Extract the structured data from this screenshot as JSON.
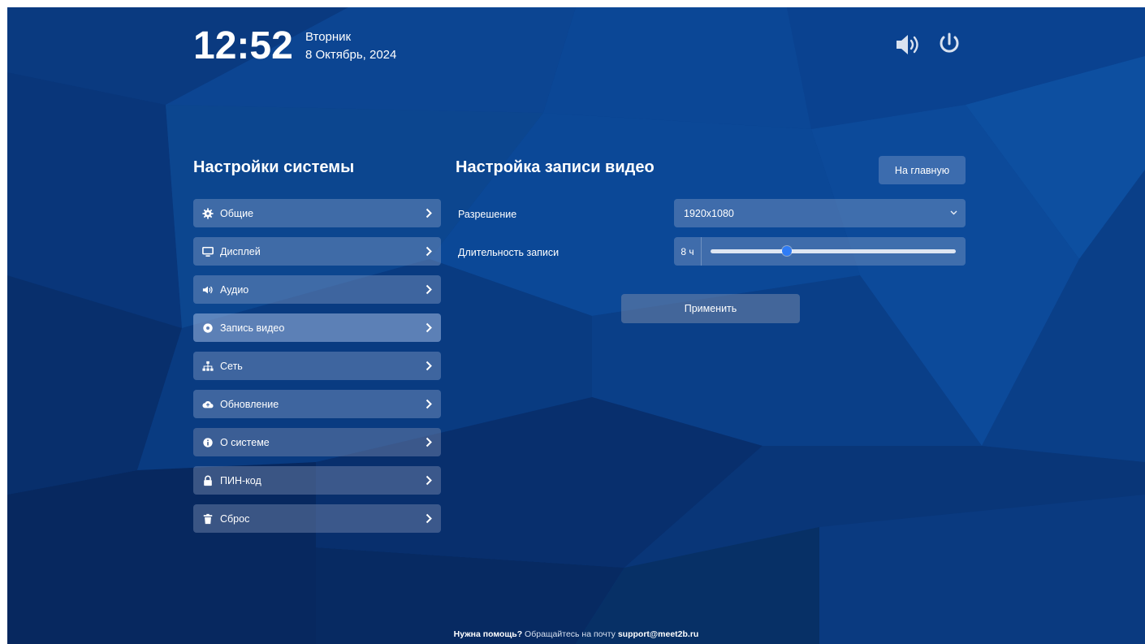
{
  "clock": {
    "time": "12:52",
    "weekday": "Вторник",
    "date": "8 Октябрь, 2024"
  },
  "sidebar": {
    "title": "Настройки системы",
    "items": [
      {
        "label": "Общие",
        "icon": "gear-icon"
      },
      {
        "label": "Дисплей",
        "icon": "monitor-icon"
      },
      {
        "label": "Аудио",
        "icon": "speaker-icon"
      },
      {
        "label": "Запись видео",
        "icon": "record-icon",
        "active": true
      },
      {
        "label": "Сеть",
        "icon": "network-icon"
      },
      {
        "label": "Обновление",
        "icon": "cloud-upload-icon"
      },
      {
        "label": "О системе",
        "icon": "info-icon"
      },
      {
        "label": "ПИН-код",
        "icon": "lock-icon"
      },
      {
        "label": "Сброс",
        "icon": "trash-icon"
      }
    ]
  },
  "panel": {
    "title": "Настройка записи видео",
    "home_label": "На главную",
    "resolution": {
      "label": "Разрешение",
      "value": "1920x1080"
    },
    "duration": {
      "label": "Длительность записи",
      "value": "8 ч",
      "slider_fraction": 0.31
    },
    "apply_label": "Применить"
  },
  "footer": {
    "help": "Нужна помощь?",
    "text": " Обращайтесь на почту ",
    "email": "support@meet2b.ru"
  },
  "colors": {
    "accent": "#2f7cf6",
    "background": "#0a3d86"
  }
}
